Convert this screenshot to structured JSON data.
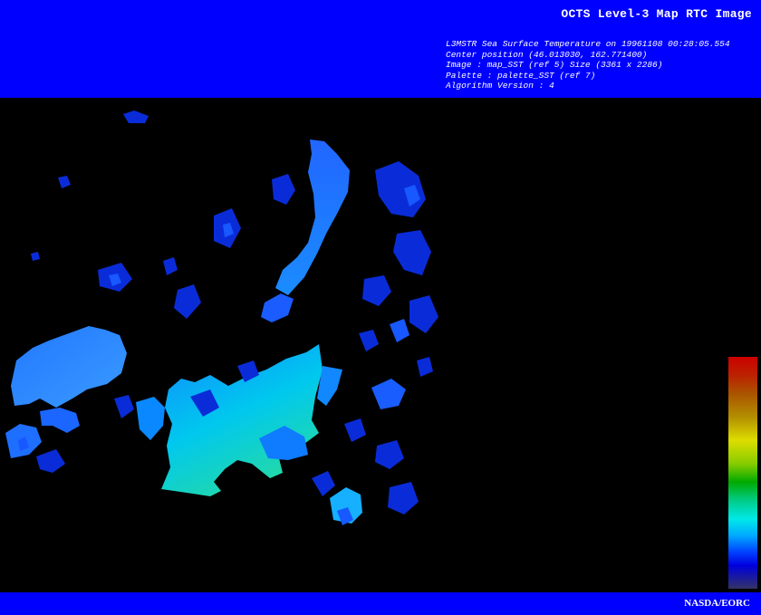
{
  "header": {
    "title": "OCTS Level-3 Map RTC Image",
    "meta_lines": [
      "L3MSTR Sea Surface Temperature on 19961108 00:28:05.554",
      "Center position (46.013030, 162.771400)",
      "Image : map_SST (ref 5) Size (3361 x 2286)",
      "Palette : palette_SST (ref 7)",
      "Algorithm Version : 4"
    ]
  },
  "footer": {
    "credit": "NASDA/EORC"
  },
  "colors": {
    "header_bg": "#0000ff",
    "image_bg": "#000000",
    "text": "#ffffff"
  },
  "palette": {
    "name": "palette_SST",
    "colors_top_to_bottom": [
      "#cc0000",
      "#aa5500",
      "#dddd00",
      "#00aa00",
      "#00e8e8",
      "#0044ff",
      "#333366"
    ]
  }
}
